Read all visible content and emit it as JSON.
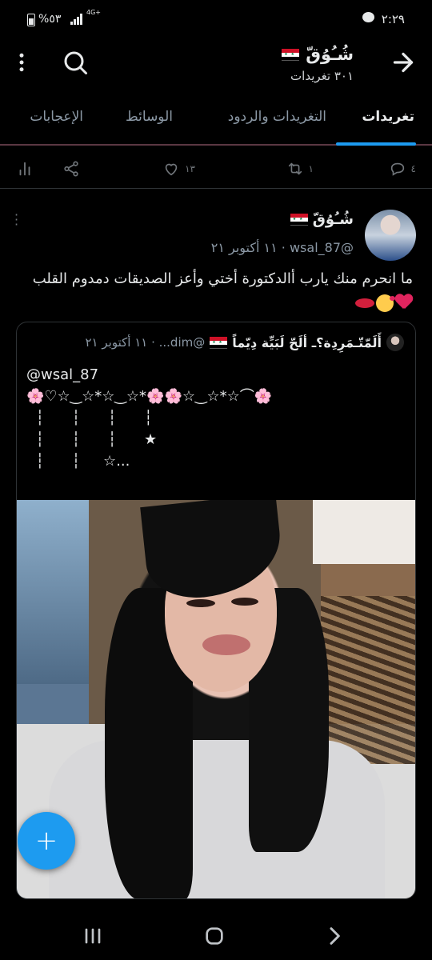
{
  "status_bar": {
    "time": "٢:٢٩",
    "battery": "%٥٣",
    "network": "4G+"
  },
  "header": {
    "profile_name": "شُـُوُقّ",
    "tweet_count": "٣٠١ تغريدات",
    "icons": [
      "back-arrow-icon",
      "search-icon",
      "more-vertical-icon"
    ]
  },
  "tabs": [
    {
      "label": "تغريدات",
      "active": true
    },
    {
      "label": "التغريدات والردود",
      "active": false
    },
    {
      "label": "الوسائط",
      "active": false
    },
    {
      "label": "الإعجابات",
      "active": false
    }
  ],
  "prev_actions": {
    "replies": "٤",
    "retweets": "١",
    "likes": "١٣"
  },
  "tweet": {
    "author_name": "شُـُوُقّ",
    "handle_date": "@wsal_87 · ١١ أكتوبر ٢١",
    "text": "ما انحرم منك يارب أالدكتورة أختي وأعز الصديقات دمدوم القلب",
    "emojis": [
      "red-heart",
      "face-blowing-kiss",
      "kiss-mark"
    ],
    "quote": {
      "author_name": "أَلَمّتّـمَرِدِة؟ـ ألَحّ لَبَيِّة دِيّماً",
      "handle_date": "@dim... · ١١ أكتوبر ٢١",
      "body": "@wsal_87\n🌸♡☆‿☆*☆‿☆*🌸🌸☆‿☆*☆⌒🌸\n  ┆      ┆      ┆      ┆\n  ┆      ┆      ┆      ★\n  ┆      ┆     ☆..."
    }
  },
  "fab": {
    "label": "+"
  },
  "colors": {
    "accent": "#1d9bf0",
    "background": "#000000",
    "text": "#e7e9ea",
    "muted": "#8b98a5",
    "heart": "#e0245e"
  }
}
